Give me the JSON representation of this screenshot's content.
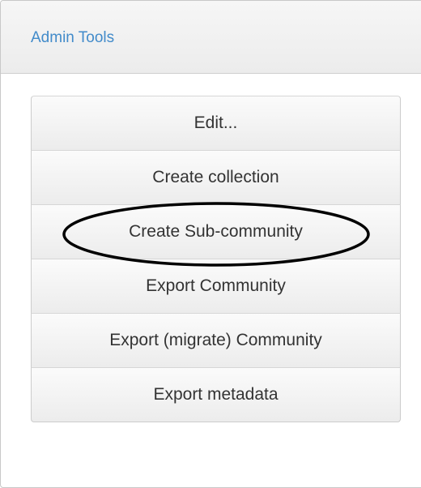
{
  "panel": {
    "title": "Admin Tools"
  },
  "menu": {
    "items": [
      {
        "label": "Edit..."
      },
      {
        "label": "Create collection"
      },
      {
        "label": "Create Sub-community"
      },
      {
        "label": "Export Community"
      },
      {
        "label": "Export (migrate) Community"
      },
      {
        "label": "Export metadata"
      }
    ]
  },
  "colors": {
    "title": "#428bca",
    "button_text": "#333333",
    "annotation": "#000000"
  }
}
